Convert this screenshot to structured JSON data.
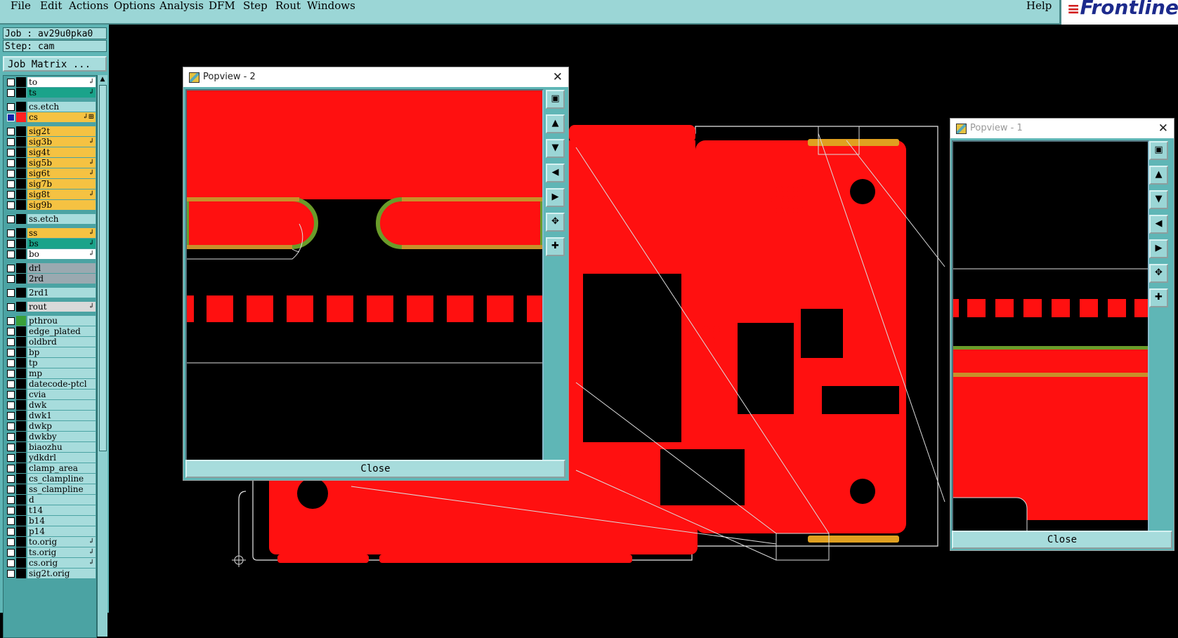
{
  "menubar": {
    "items": [
      "File",
      "Edit",
      "Actions",
      "Options",
      "Analysis",
      "DFM",
      "Step",
      "Rout",
      "Windows"
    ],
    "help": "Help"
  },
  "logo": {
    "text": "Frontline"
  },
  "panel": {
    "job": "Job : av29u0pka0",
    "step": "Step: cam",
    "job_matrix": "Job Matrix ..."
  },
  "layers": [
    {
      "name": "to",
      "color": "#ffffff",
      "arrow": "↲",
      "swatch": "#000000"
    },
    {
      "name": "ts",
      "color": "#1aa38a",
      "arrow": "↲",
      "swatch": "#000000"
    },
    {
      "name": "cs.etch",
      "color": "#a7dcdc",
      "arrow": "",
      "swatch": "#000000"
    },
    {
      "name": "cs",
      "color": "#f5c242",
      "arrow": "↲⊞",
      "swatch": "#ff2020",
      "checked": true
    },
    {
      "name": "sig2t",
      "color": "#f5c242",
      "arrow": "",
      "swatch": "#000000"
    },
    {
      "name": "sig3b",
      "color": "#f5c242",
      "arrow": "↲",
      "swatch": "#000000"
    },
    {
      "name": "sig4t",
      "color": "#f5c242",
      "arrow": "",
      "swatch": "#000000"
    },
    {
      "name": "sig5b",
      "color": "#f5c242",
      "arrow": "↲",
      "swatch": "#000000"
    },
    {
      "name": "sig6t",
      "color": "#f5c242",
      "arrow": "↲",
      "swatch": "#000000"
    },
    {
      "name": "sig7b",
      "color": "#f5c242",
      "arrow": "",
      "swatch": "#000000"
    },
    {
      "name": "sig8t",
      "color": "#f5c242",
      "arrow": "↲",
      "swatch": "#000000"
    },
    {
      "name": "sig9b",
      "color": "#f5c242",
      "arrow": "",
      "swatch": "#000000"
    },
    {
      "name": "ss.etch",
      "color": "#a7dcdc",
      "arrow": "",
      "swatch": "#000000"
    },
    {
      "name": "ss",
      "color": "#f5c242",
      "arrow": "↲",
      "swatch": "#000000"
    },
    {
      "name": "bs",
      "color": "#1aa38a",
      "arrow": "↲",
      "swatch": "#000000"
    },
    {
      "name": "bo",
      "color": "#ffffff",
      "arrow": "↲",
      "swatch": "#000000"
    },
    {
      "name": "drl",
      "color": "#9aa9b0",
      "arrow": "",
      "swatch": "#000000"
    },
    {
      "name": "2rd",
      "color": "#9aa9b0",
      "arrow": "",
      "swatch": "#000000"
    },
    {
      "name": "2rd1",
      "color": "#a7dcdc",
      "arrow": "",
      "swatch": "#000000"
    },
    {
      "name": "rout",
      "color": "#d9d9d9",
      "arrow": "↲",
      "swatch": "#000000"
    },
    {
      "name": "pthrou",
      "color": "#a7dcdc",
      "arrow": "",
      "swatch": "#3aa03a"
    },
    {
      "name": "edge_plated",
      "color": "#a7dcdc",
      "arrow": "",
      "swatch": "#000000"
    },
    {
      "name": "oldbrd",
      "color": "#a7dcdc",
      "arrow": "",
      "swatch": "#000000"
    },
    {
      "name": "bp",
      "color": "#a7dcdc",
      "arrow": "",
      "swatch": "#000000"
    },
    {
      "name": "tp",
      "color": "#a7dcdc",
      "arrow": "",
      "swatch": "#000000"
    },
    {
      "name": "mp",
      "color": "#a7dcdc",
      "arrow": "",
      "swatch": "#000000"
    },
    {
      "name": "datecode-ptcl",
      "color": "#a7dcdc",
      "arrow": "",
      "swatch": "#000000"
    },
    {
      "name": "cvia",
      "color": "#a7dcdc",
      "arrow": "",
      "swatch": "#000000"
    },
    {
      "name": "dwk",
      "color": "#a7dcdc",
      "arrow": "",
      "swatch": "#000000"
    },
    {
      "name": "dwk1",
      "color": "#a7dcdc",
      "arrow": "",
      "swatch": "#000000"
    },
    {
      "name": "dwkp",
      "color": "#a7dcdc",
      "arrow": "",
      "swatch": "#000000"
    },
    {
      "name": "dwkby",
      "color": "#a7dcdc",
      "arrow": "",
      "swatch": "#000000"
    },
    {
      "name": "biaozhu",
      "color": "#a7dcdc",
      "arrow": "",
      "swatch": "#000000"
    },
    {
      "name": "ydkdrl",
      "color": "#a7dcdc",
      "arrow": "",
      "swatch": "#000000"
    },
    {
      "name": "clamp_area",
      "color": "#a7dcdc",
      "arrow": "",
      "swatch": "#000000"
    },
    {
      "name": "cs_clampline",
      "color": "#a7dcdc",
      "arrow": "",
      "swatch": "#000000"
    },
    {
      "name": "ss_clampline",
      "color": "#a7dcdc",
      "arrow": "",
      "swatch": "#000000"
    },
    {
      "name": "d",
      "color": "#a7dcdc",
      "arrow": "",
      "swatch": "#000000"
    },
    {
      "name": "t14",
      "color": "#a7dcdc",
      "arrow": "",
      "swatch": "#000000"
    },
    {
      "name": "b14",
      "color": "#a7dcdc",
      "arrow": "",
      "swatch": "#000000"
    },
    {
      "name": "p14",
      "color": "#a7dcdc",
      "arrow": "",
      "swatch": "#000000"
    },
    {
      "name": "to.orig",
      "color": "#a7dcdc",
      "arrow": "↲",
      "swatch": "#000000"
    },
    {
      "name": "ts.orig",
      "color": "#a7dcdc",
      "arrow": "↲",
      "swatch": "#000000"
    },
    {
      "name": "cs.orig",
      "color": "#a7dcdc",
      "arrow": "↲",
      "swatch": "#000000"
    },
    {
      "name": "sig2t.orig",
      "color": "#a7dcdc",
      "arrow": "",
      "swatch": "#000000"
    }
  ],
  "popview2": {
    "title": "Popview - 2",
    "close_label": "Close",
    "close_x": "✕"
  },
  "popview1": {
    "title": "Popview - 1",
    "close_label": "Close",
    "close_x": "✕"
  },
  "colors": {
    "copper": "#ff1010",
    "panel": "#5fb6b6",
    "menubar": "#9bd6d6"
  }
}
